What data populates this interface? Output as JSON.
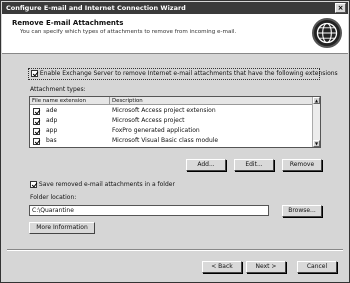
{
  "window": {
    "title": "Configure E-mail and Internet Connection Wizard"
  },
  "header": {
    "title": "Remove E-mail Attachments",
    "subtitle": "You can specify which types of attachments to remove from incoming e-mail."
  },
  "enable_checkbox": {
    "label": "Enable Exchange Server to remove Internet e-mail attachments that have the following extensions",
    "checked": true
  },
  "attachments": {
    "label": "Attachment types:",
    "columns": [
      "File name extension",
      "Description"
    ],
    "rows": [
      {
        "ext": "ade",
        "desc": "Microsoft Access project extension",
        "checked": true
      },
      {
        "ext": "adp",
        "desc": "Microsoft Access project",
        "checked": true
      },
      {
        "ext": "app",
        "desc": "FoxPro generated application",
        "checked": true
      },
      {
        "ext": "bas",
        "desc": "Microsoft Visual Basic class module",
        "checked": true
      }
    ]
  },
  "list_buttons": {
    "add": "Add...",
    "edit": "Edit...",
    "remove": "Remove"
  },
  "save_checkbox": {
    "label": "Save removed e-mail attachments in a folder",
    "checked": true
  },
  "folder": {
    "label": "Folder location:",
    "value": "C:\\Quarantine",
    "browse": "Browse..."
  },
  "more_info": "More Information",
  "nav": {
    "back": "< Back",
    "next": "Next >",
    "cancel": "Cancel"
  },
  "icons": {
    "globe": "globe-icon",
    "close": "close-icon"
  }
}
